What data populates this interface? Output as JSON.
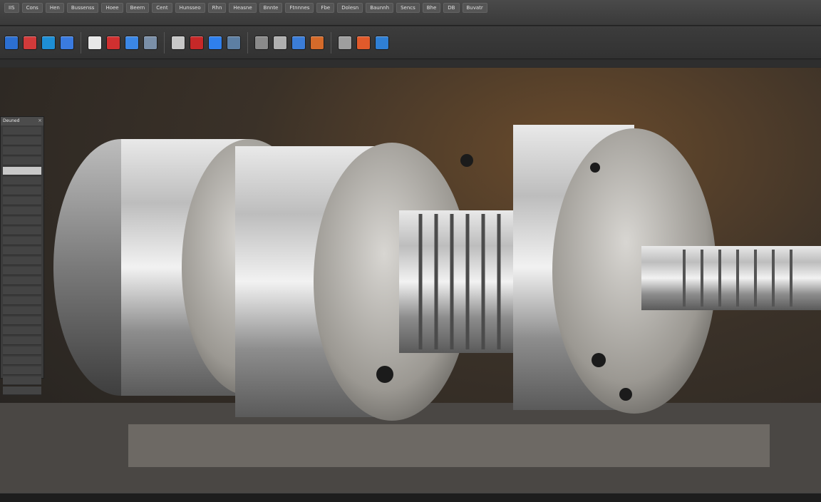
{
  "menubar": {
    "items": [
      "IIS",
      "Cons",
      "Hen",
      "Bussenss",
      "Hoee",
      "Beern",
      "Cent",
      "Hunsseo",
      "Rhn",
      "Heasne",
      "Bnnte",
      "Ftnnnes",
      "Fbe",
      "Dolesn",
      "Baunnh",
      "Sencs",
      "Bhe",
      "DB",
      "Buvatr"
    ]
  },
  "toolbar": {
    "tools": [
      {
        "icon": "save-icon",
        "color": "#2c6fd1"
      },
      {
        "icon": "open-icon",
        "color": "#d13a3a"
      },
      {
        "icon": "sketch-icon",
        "color": "#1e8fd6"
      },
      {
        "icon": "extrude-icon",
        "color": "#3a7be0"
      },
      {
        "icon": "document-icon",
        "color": "#e8e8e8"
      },
      {
        "icon": "shape-icon",
        "color": "#d03030"
      },
      {
        "icon": "view-icon",
        "color": "#3b87e6"
      },
      {
        "icon": "layer-icon",
        "color": "#7a8fa8"
      },
      {
        "icon": "revolve-icon",
        "color": "#c7c7c7"
      },
      {
        "icon": "record-icon",
        "color": "#c62828"
      },
      {
        "icon": "cube-icon",
        "color": "#2f80ed"
      },
      {
        "icon": "move-icon",
        "color": "#5d7fa3"
      },
      {
        "icon": "grid-icon",
        "color": "#8a8a8a"
      },
      {
        "icon": "mirror-icon",
        "color": "#b0b0b0"
      },
      {
        "icon": "pattern-icon",
        "color": "#3b7dd8"
      },
      {
        "icon": "chart-icon",
        "color": "#d46a2a"
      },
      {
        "icon": "measure-icon",
        "color": "#9e9e9e"
      },
      {
        "icon": "render-icon",
        "color": "#e05a2b"
      },
      {
        "icon": "help-icon",
        "color": "#2f7fd4"
      }
    ]
  },
  "panel": {
    "title": "Deuned",
    "rows": [
      "",
      "",
      "",
      "",
      "",
      "",
      "",
      "",
      "",
      "",
      "",
      "",
      "",
      "",
      "",
      "",
      "",
      "",
      "",
      "",
      "",
      "",
      "",
      "",
      "",
      "",
      ""
    ],
    "selected_index": 4
  },
  "statusbar": {
    "text": ""
  }
}
